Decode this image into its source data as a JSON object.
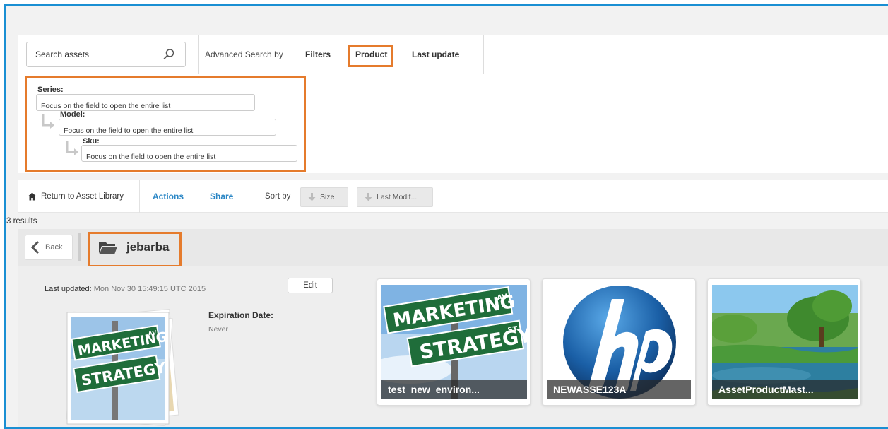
{
  "search": {
    "placeholder": "Search assets",
    "advanced_label": "Advanced Search by",
    "tabs": [
      "Filters",
      "Product",
      "Last update"
    ]
  },
  "product_search": {
    "series_label": "Series:",
    "model_label": "Model:",
    "sku_label": "Sku:",
    "field_placeholder": "Focus on the field to open the entire list"
  },
  "toolbar": {
    "return_label": "Return to Asset Library",
    "actions_label": "Actions",
    "share_label": "Share",
    "sort_by_label": "Sort by",
    "sort_size_label": "Size",
    "sort_modified_label": "Last Modif..."
  },
  "results_count": "3 results",
  "folder": {
    "back_label": "Back",
    "name": "jebarba",
    "last_updated_label": "Last updated:",
    "last_updated_value": "Mon Nov 30 15:49:15 UTC 2015",
    "edit_label": "Edit",
    "expiration_label": "Expiration Date:",
    "expiration_value": "Never"
  },
  "assets": [
    {
      "name": "test_new_environ...",
      "thumb": "marketing-strategy-sign"
    },
    {
      "name": "NEWASSE123A",
      "thumb": "hp-logo"
    },
    {
      "name": "AssetProductMast...",
      "thumb": "landscape-lake"
    }
  ],
  "sign_text": {
    "line1": "MARKETING",
    "line1_suffix": "AV",
    "line2": "STRATEGY",
    "line2_suffix": "ST"
  },
  "colors": {
    "accent": "#2a86c5",
    "highlight": "#e57b2c",
    "frame": "#1a8fd3"
  }
}
